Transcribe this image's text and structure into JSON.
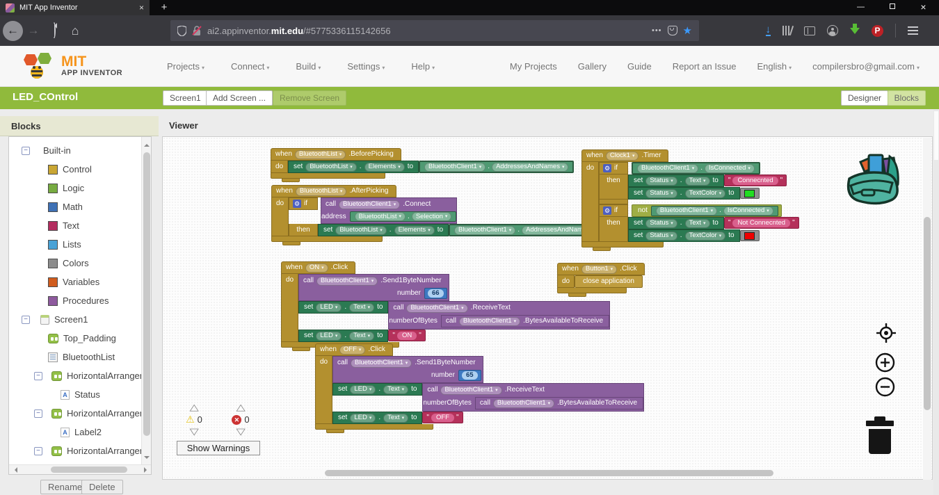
{
  "browser": {
    "tab_title": "MIT App Inventor",
    "url_prefix": "ai2.appinventor.",
    "url_domain": "mit.edu",
    "url_path": "/#5775336115142656",
    "dots": "•••"
  },
  "glyphs": {
    "close": "×",
    "minimize": "—",
    "plus": "+",
    "back": "←",
    "forward": "→",
    "home": "⌂",
    "star": "★",
    "caret": "▾",
    "minus": "−",
    "gear": "⚙",
    "warning": "⚠",
    "cross": "✕",
    "tri_up": "△",
    "tri_down": "▽",
    "letter_a": "A",
    "pinterest_p": "P"
  },
  "header": {
    "logo_line1": "MIT",
    "logo_line2": "APP INVENTOR",
    "menus": {
      "projects": "Projects",
      "connect": "Connect",
      "build": "Build",
      "settings": "Settings",
      "help": "Help"
    },
    "links": {
      "my_projects": "My Projects",
      "gallery": "Gallery",
      "guide": "Guide",
      "report": "Report an Issue",
      "language": "English",
      "account": "compilersbro@gmail.com"
    }
  },
  "project_bar": {
    "project_name": "LED_COntrol",
    "screen_selector": "Screen1",
    "add_screen": "Add Screen ...",
    "remove_screen": "Remove Screen",
    "designer": "Designer",
    "blocks": "Blocks"
  },
  "sidebar": {
    "title": "Blocks",
    "builtin_label": "Built-in",
    "builtin": [
      {
        "label": "Control",
        "color": "#c9a633"
      },
      {
        "label": "Logic",
        "color": "#77ab41"
      },
      {
        "label": "Math",
        "color": "#3f71b5"
      },
      {
        "label": "Text",
        "color": "#b32d5f"
      },
      {
        "label": "Lists",
        "color": "#49a2d6"
      },
      {
        "label": "Colors",
        "color": "#8c8c8c"
      },
      {
        "label": "Variables",
        "color": "#d05c1e"
      },
      {
        "label": "Procedures",
        "color": "#8e5a9e"
      }
    ],
    "screen_label": "Screen1",
    "screen_items": [
      {
        "label": "Top_Padding"
      },
      {
        "label": "BluetoothList"
      },
      {
        "label": "HorizontalArrangemen"
      },
      {
        "label": "Status"
      },
      {
        "label": "HorizontalArrangemen"
      },
      {
        "label": "Label2"
      },
      {
        "label": "HorizontalArrangemen"
      }
    ],
    "rename": "Rename",
    "delete": "Delete"
  },
  "viewer": {
    "title": "Viewer"
  },
  "blocks": {
    "kw": {
      "when": "when",
      "do": "do",
      "then": "then",
      "set": "set",
      "call": "call",
      "to": "to",
      "if": "if",
      "not": "not",
      "address": "address",
      "number": "number",
      "numberOfBytes": "numberOfBytes",
      "dot": "."
    },
    "refs": {
      "bluetoothList": "BluetoothList",
      "bluetoothClient": "BluetoothClient1",
      "clock": "Clock1",
      "status": "Status",
      "led": "LED",
      "on": "ON",
      "off": "OFF",
      "button1": "Button1",
      "elements": "Elements",
      "addressesAndNames": "AddressesAndNames",
      "selection": "Selection",
      "isConnected": "IsConnected",
      "text": "Text",
      "textColor": "TextColor"
    },
    "events": {
      "beforePicking": ".BeforePicking",
      "afterPicking": ".AfterPicking",
      "timer": ".Timer",
      "click": ".Click"
    },
    "methods": {
      "connect": ".Connect",
      "send1Byte": ".Send1ByteNumber",
      "receiveText": ".ReceiveText",
      "bytesAvailable": ".BytesAvailableToReceive"
    },
    "values": {
      "quote": "\"",
      "on_number": "66",
      "off_number": "65",
      "on_text": "ON",
      "off_text": "OFF",
      "connected_text": "Connecnted",
      "not_connected_text": "Not Connecnted",
      "close_app": "close application"
    },
    "colors": {
      "connected": "#22dd22",
      "disconnected": "#ee0000"
    }
  },
  "warnings": {
    "warning_count": "0",
    "error_count": "0",
    "show_warnings": "Show Warnings"
  }
}
